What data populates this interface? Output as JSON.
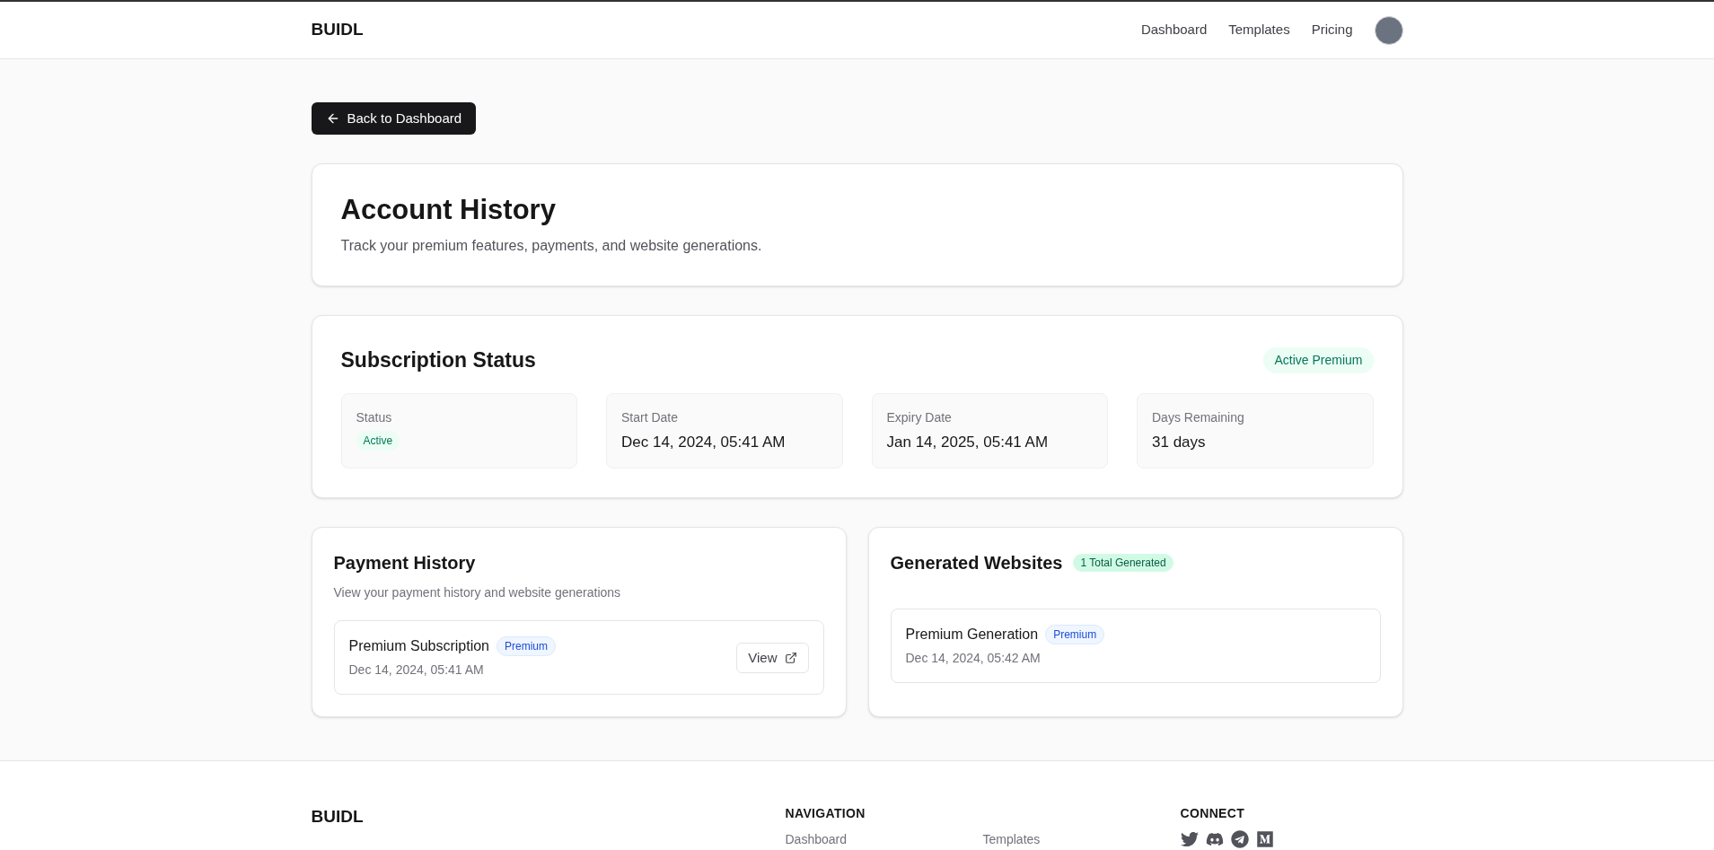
{
  "header": {
    "logo": "BUIDL",
    "nav": [
      "Dashboard",
      "Templates",
      "Pricing"
    ]
  },
  "back_button": "Back to Dashboard",
  "intro": {
    "title": "Account History",
    "subtitle": "Track your premium features, payments, and website generations."
  },
  "subscription": {
    "title": "Subscription Status",
    "badge": "Active Premium",
    "stats": [
      {
        "kind": "badge",
        "label": "Status",
        "value": "Active"
      },
      {
        "kind": "text",
        "label": "Start Date",
        "value": "Dec 14, 2024, 05:41 AM"
      },
      {
        "kind": "text",
        "label": "Expiry Date",
        "value": "Jan 14, 2025, 05:41 AM"
      },
      {
        "kind": "text",
        "label": "Days Remaining",
        "value": "31 days"
      }
    ]
  },
  "payments": {
    "title": "Payment History",
    "subtitle": "View your payment history and website generations",
    "items": [
      {
        "title": "Premium Subscription",
        "tag": "Premium",
        "date": "Dec 14, 2024, 05:41 AM",
        "action": "View"
      }
    ]
  },
  "websites": {
    "title": "Generated Websites",
    "badge": "1 Total Generated",
    "items": [
      {
        "title": "Premium Generation",
        "tag": "Premium",
        "date": "Dec 14, 2024, 05:42 AM"
      }
    ]
  },
  "footer": {
    "logo": "BUIDL",
    "nav_heading": "NAVIGATION",
    "nav": [
      "Dashboard",
      "Templates"
    ],
    "connect_heading": "CONNECT"
  }
}
